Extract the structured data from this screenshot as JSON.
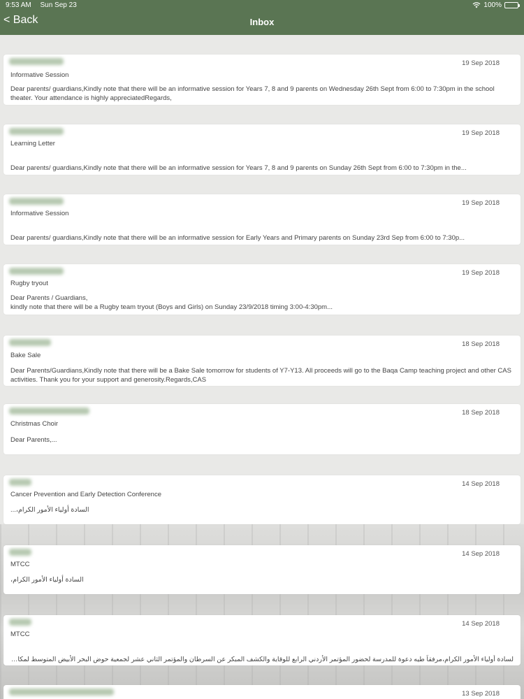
{
  "status": {
    "time": "9:53 AM",
    "date": "Sun Sep 23",
    "battery": "100%"
  },
  "nav": {
    "back_label": "< Back",
    "title": "Inbox"
  },
  "messages": [
    {
      "date": "19 Sep 2018",
      "subject": "Informative Session",
      "body": "Dear parents/ guardians,Kindly note that there will be an informative session for Years 7, 8 and 9 parents on Wednesday 26th Sept from 6:00 to 7:30pm in the school theater. Your attendance is highly appreciatedRegards,"
    },
    {
      "date": "19 Sep 2018",
      "subject": "Learning Letter",
      "body": "Dear parents/ guardians,Kindly note that there will be an informative session for Years 7, 8 and 9 parents on Sunday 26th Sept from 6:00 to 7:30pm in the..."
    },
    {
      "date": "19 Sep 2018",
      "subject": "Informative Session",
      "body": "Dear parents/ guardians,Kindly note that there will be an informative session for Early Years and Primary parents on Sunday 23rd Sep from 6:00 to 7:30p..."
    },
    {
      "date": "19 Sep 2018",
      "subject": "Rugby tryout",
      "body_line1": "Dear Parents / Guardians,",
      "body_line2": "kindly note that there will be a Rugby team tryout (Boys and Girls) on Sunday 23/9/2018 timing 3:00-4:30pm..."
    },
    {
      "date": "18 Sep 2018",
      "subject": "Bake Sale",
      "body": "Dear Parents/Guardians,Kindly note that there will be a Bake Sale tomorrow for students of Y7-Y13. All proceeds will go to the Baqa Camp teaching project and other CAS activities. Thank you for your support and generosity.Regards,CAS"
    },
    {
      "date": "18 Sep 2018",
      "subject": "Christmas Choir",
      "body": "Dear Parents,..."
    },
    {
      "date": "14 Sep 2018",
      "subject": "Cancer Prevention and Early Detection Conference",
      "body": "السادة أولياء الأمور الكرام،..."
    },
    {
      "date": "14 Sep 2018",
      "subject": "MTCC",
      "body": "السادة أولياء الأمور الكرام،"
    },
    {
      "date": "14 Sep 2018",
      "subject": "MTCC",
      "body": "لسادة أولياء الأمور الكرام،مرفقاً طيه دعوة للمدرسة لحضور المؤتمر الأردني الرابع للوقاية والكشف المبكر عن السرطان والمؤتمر الثاني عشر لجمعية حوض البحر الأبيض المتوسط لمكافح..."
    },
    {
      "date": "13 Sep 2018"
    }
  ]
}
